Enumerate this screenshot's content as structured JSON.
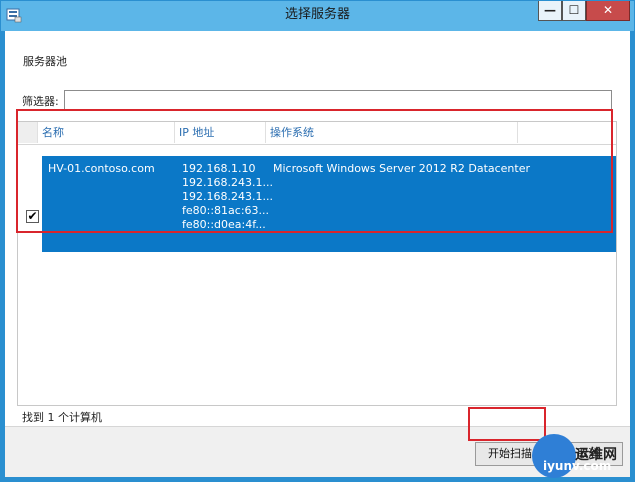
{
  "window": {
    "title": "选择服务器",
    "min_glyph": "—",
    "max_glyph": "☐",
    "close_glyph": "✕"
  },
  "pool": {
    "label": "服务器池",
    "filter_label": "筛选器:",
    "filter_value": ""
  },
  "grid": {
    "headers": {
      "name": "名称",
      "ip": "IP 地址",
      "os": "操作系统"
    },
    "rows": [
      {
        "checked": true,
        "check_glyph": "✔",
        "name": "HV-01.contoso.com",
        "ips": [
          "192.168.1.10",
          "192.168.243.1...",
          "192.168.243.1...",
          "fe80::81ac:63...",
          "fe80::d0ea:4f..."
        ],
        "os": "Microsoft Windows Server 2012 R2 Datacenter"
      }
    ]
  },
  "status": {
    "found": "找到 1 个计算机"
  },
  "buttons": {
    "start_scan": "开始扫描",
    "close": "取消"
  },
  "watermark": {
    "top": "运维网",
    "bottom": "iyunv.com"
  },
  "colors": {
    "title_bar": "#5cb6e8",
    "selection": "#0b78c7",
    "highlight": "#d9252c",
    "header_text": "#2a6db0"
  }
}
